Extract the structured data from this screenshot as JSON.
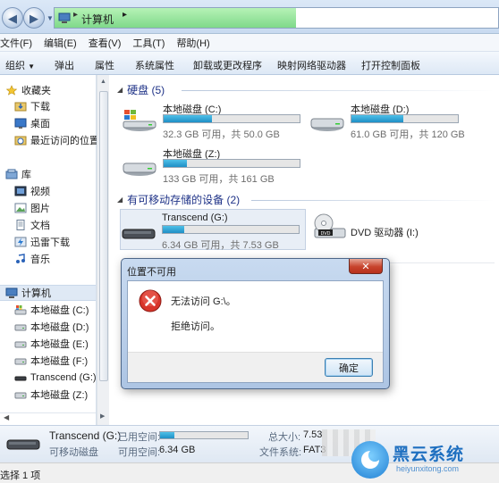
{
  "address_bar": {
    "path_label": "计算机"
  },
  "menu": [
    "文件(F)",
    "编辑(E)",
    "查看(V)",
    "工具(T)",
    "帮助(H)"
  ],
  "toolbar": {
    "organize": "组织",
    "eject": "弹出",
    "properties": "属性",
    "system_properties": "系统属性",
    "uninstall": "卸载或更改程序",
    "map_drive": "映射网络驱动器",
    "control_panel": "打开控制面板"
  },
  "nav": {
    "favorites": "收藏夹",
    "downloads": "下载",
    "desktop": "桌面",
    "recent": "最近访问的位置",
    "libraries": "库",
    "videos": "视频",
    "pictures": "图片",
    "documents": "文档",
    "thunder": "迅雷下载",
    "music": "音乐",
    "computer": "计算机",
    "c": "本地磁盘 (C:)",
    "d": "本地磁盘 (D:)",
    "e": "本地磁盘 (E:)",
    "f": "本地磁盘 (F:)",
    "g": "Transcend (G:)",
    "z": "本地磁盘 (Z:)"
  },
  "content": {
    "hard_disks_header": "硬盘 (5)",
    "removable_header": "有可移动存储的设备 (2)",
    "drives": {
      "c": {
        "name": "本地磁盘 (C:)",
        "size": "32.3 GB 可用，共 50.0 GB",
        "used": 0.354
      },
      "d": {
        "name": "本地磁盘 (D:)",
        "size": "61.0 GB 可用，共 120 GB",
        "used": 0.49
      },
      "z": {
        "name": "本地磁盘 (Z:)",
        "size": "133 GB 可用，共 161 GB",
        "used": 0.17
      },
      "g": {
        "name": "Transcend (G:)",
        "size": "6.34 GB 可用，共 7.53 GB",
        "used": 0.16
      },
      "dvd": {
        "name": "DVD 驱动器 (I:)"
      }
    }
  },
  "details": {
    "name": "Transcend (G:)",
    "type": "可移动磁盘",
    "used_label": "已用空间:",
    "free_label": "可用空间:",
    "free_value": "6.34 GB",
    "total_label": "总大小:",
    "total_value": "7.53",
    "fs_label": "文件系统:",
    "fs_value": "FAT3",
    "used": 0.16
  },
  "status": {
    "selected": "选择 1 项"
  },
  "watermark": {
    "title": "黑云系统",
    "url": "heiyunxitong.com"
  },
  "dialog": {
    "title": "位置不可用",
    "close_glyph": "✕",
    "message": "无法访问 G:\\。",
    "detail": "拒绝访问。",
    "ok": "确定"
  }
}
